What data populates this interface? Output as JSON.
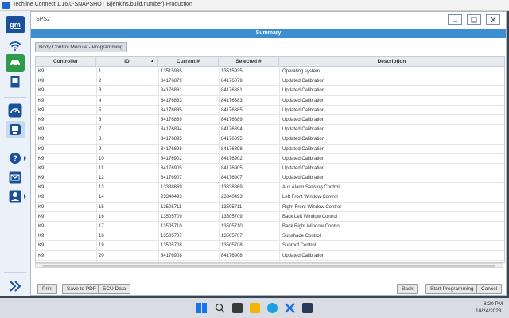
{
  "window": {
    "title": "Techline Connect 1.16.0-SNAPSHOT ${jenkins.build.number} Production"
  },
  "sidebar": {
    "logo": "gm",
    "items": [
      {
        "icon": "wifi-icon"
      },
      {
        "icon": "vehicle-icon"
      },
      {
        "icon": "book-icon"
      },
      {
        "icon": "gauge-icon"
      },
      {
        "icon": "module-icon"
      },
      {
        "icon": "help-icon"
      },
      {
        "icon": "mail-icon"
      },
      {
        "icon": "user-icon"
      }
    ],
    "expand_icon": "double-chevron-right-icon"
  },
  "dialog": {
    "name": "SPS2",
    "summary": "Summary",
    "module_tab": "Body Control Module - Programming"
  },
  "table": {
    "headers": {
      "controller": "Controller",
      "id": "ID",
      "current": "Current #",
      "selected": "Selected #",
      "description": "Description"
    },
    "rows": [
      {
        "controller": "K9",
        "id": "1",
        "current": "13515935",
        "selected": "13515935",
        "description": "Operating system"
      },
      {
        "controller": "K9",
        "id": "2",
        "current": "84176879",
        "selected": "84176879",
        "description": "Updated Calibration"
      },
      {
        "controller": "K9",
        "id": "3",
        "current": "84176881",
        "selected": "84176881",
        "description": "Updated Calibration"
      },
      {
        "controller": "K9",
        "id": "4",
        "current": "84176883",
        "selected": "84176883",
        "description": "Updated Calibration"
      },
      {
        "controller": "K9",
        "id": "5",
        "current": "84176885",
        "selected": "84176885",
        "description": "Updated Calibration"
      },
      {
        "controller": "K9",
        "id": "6",
        "current": "84176889",
        "selected": "84176889",
        "description": "Updated Calibration"
      },
      {
        "controller": "K9",
        "id": "7",
        "current": "84176894",
        "selected": "84176894",
        "description": "Updated Calibration"
      },
      {
        "controller": "K9",
        "id": "8",
        "current": "84176895",
        "selected": "84176895",
        "description": "Updated Calibration"
      },
      {
        "controller": "K9",
        "id": "9",
        "current": "84176898",
        "selected": "84176898",
        "description": "Updated Calibration"
      },
      {
        "controller": "K9",
        "id": "10",
        "current": "84176902",
        "selected": "84176902",
        "description": "Updated Calibration"
      },
      {
        "controller": "K9",
        "id": "11",
        "current": "84176905",
        "selected": "84176905",
        "description": "Updated Calibration"
      },
      {
        "controller": "K9",
        "id": "12",
        "current": "84176907",
        "selected": "84176907",
        "description": "Updated Calibration"
      },
      {
        "controller": "K9",
        "id": "13",
        "current": "13338869",
        "selected": "13338869",
        "description": "Aux Alarm Sensing Control"
      },
      {
        "controller": "K9",
        "id": "14",
        "current": "23340493",
        "selected": "23340493",
        "description": "Left Front Window Control"
      },
      {
        "controller": "K9",
        "id": "15",
        "current": "13505711",
        "selected": "13505711",
        "description": "Right Front Window Control"
      },
      {
        "controller": "K9",
        "id": "16",
        "current": "13505709",
        "selected": "13505709",
        "description": "Back Left Window Control"
      },
      {
        "controller": "K9",
        "id": "17",
        "current": "13505710",
        "selected": "13505710",
        "description": "Back Right Window Control"
      },
      {
        "controller": "K9",
        "id": "18",
        "current": "13505707",
        "selected": "13505707",
        "description": "Sunshade Control"
      },
      {
        "controller": "K9",
        "id": "19",
        "current": "13505708",
        "selected": "13505708",
        "description": "Sunroof Control"
      },
      {
        "controller": "K9",
        "id": "20",
        "current": "84176908",
        "selected": "84176908",
        "description": "Updated Calibration"
      }
    ]
  },
  "buttons": {
    "print": "Print",
    "save_pdf": "Save to PDF",
    "ecu_data": "ECU Data",
    "back": "Back",
    "start": "Start Programming",
    "cancel": "Cancel"
  },
  "taskbar": {
    "time": "8:20 PM",
    "date": "10/24/2023"
  },
  "colors": {
    "accent": "#3d8ed1",
    "gm_blue": "#1a4f9a"
  }
}
